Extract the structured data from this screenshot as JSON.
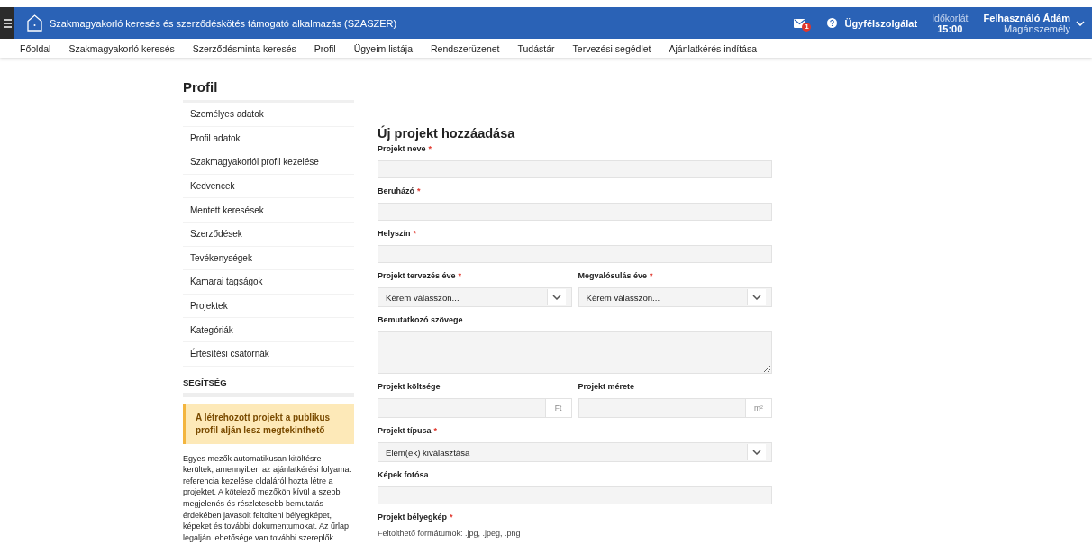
{
  "header": {
    "title": "Szakmagyakorló keresés és szerződéskötés támogató alkalmazás (SZASZER)",
    "message_count": "1",
    "support": "Ügyfélszolgálat",
    "timer_label": "Időkorlát",
    "timer_value": "15:00",
    "user_name": "Felhasználó Ádám",
    "user_role": "Magánszemély"
  },
  "nav": [
    {
      "label": "Főoldal"
    },
    {
      "label": "Szakmagyakorló keresés"
    },
    {
      "label": "Szerződésminta keresés"
    },
    {
      "label": "Profil"
    },
    {
      "label": "Ügyeim listája"
    },
    {
      "label": "Rendszerüzenet"
    },
    {
      "label": "Tudástár"
    },
    {
      "label": "Tervezési segédlet"
    },
    {
      "label": "Ajánlatkérés indítása"
    }
  ],
  "sidebar": {
    "title": "Profil",
    "items": [
      {
        "label": "Személyes adatok"
      },
      {
        "label": "Profil adatok"
      },
      {
        "label": "Szakmagyakorlói profil kezelése"
      },
      {
        "label": "Kedvencek"
      },
      {
        "label": "Mentett keresések"
      },
      {
        "label": "Szerződések"
      },
      {
        "label": "Tevékenységek"
      },
      {
        "label": "Kamarai tagságok"
      },
      {
        "label": "Projektek"
      },
      {
        "label": "Kategóriák"
      },
      {
        "label": "Értesítési csatornák"
      }
    ],
    "help_title": "SEGÍTSÉG",
    "notice": "A létrehozott projekt a publikus profil alján lesz megtekinthető",
    "help_text": "Egyes mezők automatikusan kitöltésre kerültek, amennyiben az ajánlatkérési folyamat referencia kezelése oldaláról hozta létre a projektet. A kötelező mezőkön kívül a szebb megjelenés és részletesebb bemutatás érdekében javasolt feltölteni bélyegképet, képeket és további dokumentumokat. Az űrlap legalján lehetősége van további szereplők"
  },
  "form": {
    "title": "Új projekt hozzáadása",
    "rows": [
      [
        {
          "kind": "text",
          "label": "Projekt neve",
          "required_mark": "*"
        }
      ],
      [
        {
          "kind": "text",
          "label": "Beruházó",
          "required_mark": "*"
        }
      ],
      [
        {
          "kind": "text",
          "label": "Helyszín",
          "required_mark": "*"
        }
      ],
      [
        {
          "kind": "select",
          "label": "Projekt tervezés éve",
          "required_mark": "*",
          "value": "Kérem válasszon..."
        },
        {
          "kind": "select",
          "label": "Megvalósulás éve",
          "required_mark": "*",
          "value": "Kérem válasszon..."
        }
      ],
      [
        {
          "kind": "textarea",
          "label": "Bemutatkozó szövege"
        }
      ],
      [
        {
          "kind": "unit",
          "label": "Projekt költsége",
          "unit": "Ft"
        },
        {
          "kind": "unit",
          "label": "Projekt mérete",
          "unit": "m²"
        }
      ],
      [
        {
          "kind": "select",
          "label": "Projekt típusa",
          "required_mark": "*",
          "value": "Elem(ek) kiválasztása"
        }
      ],
      [
        {
          "kind": "text",
          "label": "Képek fotósa"
        }
      ],
      [
        {
          "kind": "upload",
          "label": "Projekt bélyegkép",
          "required_mark": "*",
          "hint": "Feltölthető formátumok: .jpg, .jpeg, .png"
        }
      ]
    ]
  }
}
